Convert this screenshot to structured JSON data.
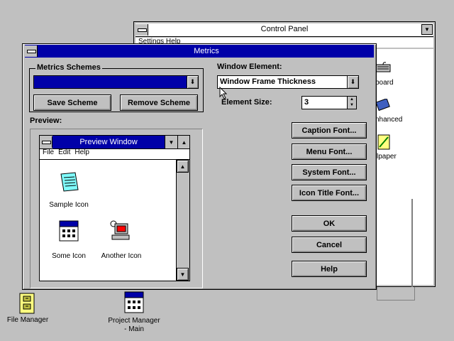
{
  "control_panel": {
    "title": "Control Panel",
    "menu_partial": "Settings  Help",
    "icons": [
      {
        "label": "board",
        "icon": "keyboard-icon"
      },
      {
        "label": "nhanced",
        "icon": "chip-icon"
      },
      {
        "label": "lpaper",
        "icon": "wallpaper-icon"
      }
    ]
  },
  "metrics": {
    "title": "Metrics",
    "schemes_label": "Metrics Schemes",
    "schemes_value": "",
    "save_scheme": "Save Scheme",
    "remove_scheme": "Remove Scheme",
    "preview_label": "Preview:",
    "window_element_label": "Window Element:",
    "window_element_value": "Window Frame Thickness",
    "element_size_label": "Element Size:",
    "element_size_value": "3",
    "caption_font": "Caption Font...",
    "menu_font": "Menu Font...",
    "system_font": "System Font...",
    "icon_title_font": "Icon Title Font...",
    "ok": "OK",
    "cancel": "Cancel",
    "help": "Help"
  },
  "preview": {
    "title": "Preview Window",
    "menu": [
      "File",
      "Edit",
      "Help"
    ],
    "icons": [
      {
        "label": "Sample Icon",
        "icon": "notepad-icon"
      },
      {
        "label": "Some Icon",
        "icon": "program-group-icon"
      },
      {
        "label": "Another Icon",
        "icon": "computer-icon"
      }
    ]
  },
  "desktop": {
    "icons": [
      {
        "label": "File Manager",
        "icon": "file-cabinet-icon"
      },
      {
        "label": "Project Manager - Main",
        "icon": "program-group-icon"
      }
    ]
  },
  "colors": {
    "active_title": "#0000a8",
    "desktop": "#c0c0c0",
    "selection": "#0000a8"
  }
}
